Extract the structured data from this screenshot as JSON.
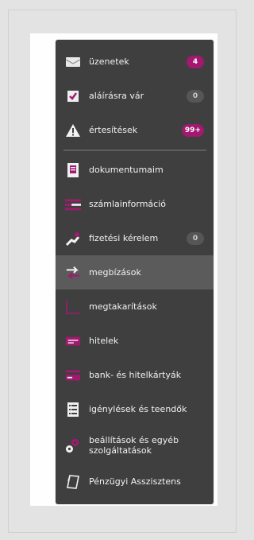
{
  "colors": {
    "menu_bg": "#3f3f3f",
    "active_bg": "#5b5b5b",
    "accent_magenta": "#a2196f",
    "badge_dark": "#565656"
  },
  "menu": {
    "items": [
      {
        "label": "üzenetek",
        "icon": "envelope-icon",
        "badge": "4",
        "badge_style": "magenta"
      },
      {
        "label": "aláírásra vár",
        "icon": "check-document-icon",
        "badge": "0",
        "badge_style": "dark"
      },
      {
        "label": "értesítések",
        "icon": "warning-icon",
        "badge": "99+",
        "badge_style": "magenta"
      },
      {
        "label": "dokumentumaim",
        "icon": "documents-icon"
      },
      {
        "label": "számlainformáció",
        "icon": "account-info-icon"
      },
      {
        "label": "fizetési kérelem",
        "icon": "payment-request-icon",
        "badge": "0",
        "badge_style": "dark"
      },
      {
        "label": "megbízások",
        "icon": "transfer-arrows-icon",
        "active": true
      },
      {
        "label": "megtakarítások",
        "icon": "savings-chart-icon"
      },
      {
        "label": "hitelek",
        "icon": "loan-icon"
      },
      {
        "label": "bank- és hitelkártyák",
        "icon": "credit-card-icon"
      },
      {
        "label": "igénylések és teendők",
        "icon": "checklist-icon"
      },
      {
        "label": "beállítások és egyéb szolgáltatások",
        "icon": "settings-gears-icon"
      },
      {
        "label": "Pénzügyi Asszisztens",
        "icon": "assistant-icon"
      }
    ]
  }
}
